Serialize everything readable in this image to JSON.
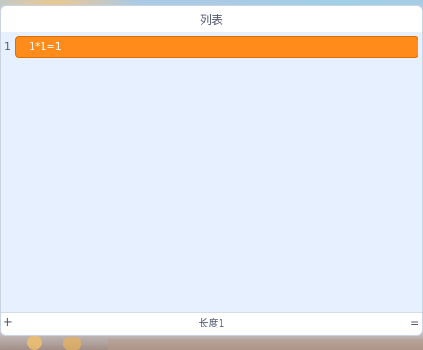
{
  "list": {
    "title": "列表",
    "items": [
      {
        "index": "1",
        "value": "1*1=1"
      }
    ],
    "length_label": "长度1",
    "add_symbol": "+",
    "resize_symbol": "="
  },
  "colors": {
    "item_fill": "#ff8c1a",
    "monitor_bg": "#e6f0ff"
  }
}
